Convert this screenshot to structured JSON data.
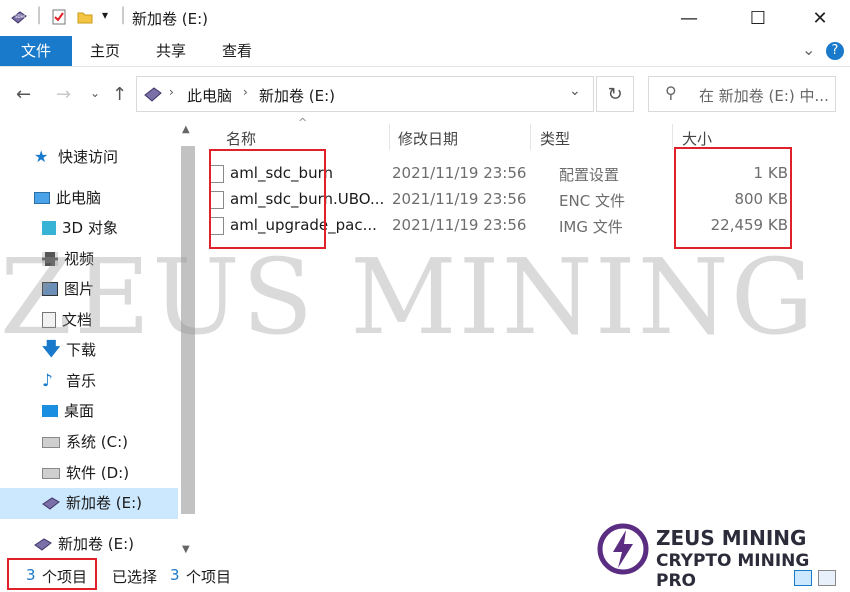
{
  "window": {
    "title": "新加卷 (E:)",
    "minimize": "—",
    "maximize": "☐",
    "close": "✕"
  },
  "ribbon": {
    "tabs": [
      "文件",
      "主页",
      "共享",
      "查看"
    ],
    "expand": "⌄",
    "help": "?"
  },
  "address": {
    "segments": [
      "此电脑",
      "新加卷 (E:)"
    ],
    "search_placeholder": "在 新加卷 (E:) 中..."
  },
  "sidebar": {
    "items": [
      {
        "label": "快速访问",
        "icon": "star-icon"
      },
      {
        "label": "此电脑",
        "icon": "computer-icon"
      },
      {
        "label": "3D 对象",
        "icon": "cube-icon"
      },
      {
        "label": "视频",
        "icon": "film-icon"
      },
      {
        "label": "图片",
        "icon": "picture-icon"
      },
      {
        "label": "文档",
        "icon": "document-icon"
      },
      {
        "label": "下载",
        "icon": "download-icon"
      },
      {
        "label": "音乐",
        "icon": "music-icon"
      },
      {
        "label": "桌面",
        "icon": "desktop-icon"
      },
      {
        "label": "系统 (C:)",
        "icon": "drive-icon"
      },
      {
        "label": "软件 (D:)",
        "icon": "drive-icon"
      },
      {
        "label": "新加卷 (E:)",
        "icon": "sd-card-icon"
      },
      {
        "label": "新加卷 (E:)",
        "icon": "sd-card-icon"
      }
    ]
  },
  "columns": {
    "name": "名称",
    "modified": "修改日期",
    "type": "类型",
    "size": "大小"
  },
  "files": [
    {
      "name": "aml_sdc_burn",
      "modified": "2021/11/19 23:56",
      "type": "配置设置",
      "size": "1 KB"
    },
    {
      "name": "aml_sdc_burn.UBO...",
      "modified": "2021/11/19 23:56",
      "type": "ENC 文件",
      "size": "800 KB"
    },
    {
      "name": "aml_upgrade_pac...",
      "modified": "2021/11/19 23:56",
      "type": "IMG 文件",
      "size": "22,459 KB"
    }
  ],
  "status": {
    "count_num": "3",
    "count_label": "个项目",
    "selected_label": "已选择",
    "selected_num": "3",
    "selected_suffix": "个项目"
  },
  "watermark": {
    "text": "ZEUS MINING",
    "logo_line1": "ZEUS MINING",
    "logo_line2": "CRYPTO MINING PRO"
  },
  "colors": {
    "accent": "#1979ca",
    "highlight": "#e0202a",
    "selection": "#cce8ff"
  }
}
